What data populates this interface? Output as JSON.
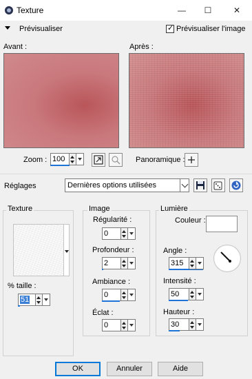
{
  "window": {
    "title": "Texture",
    "minimize": "—",
    "maximize": "☐",
    "close": "✕"
  },
  "preview_toggle": {
    "label": "Prévisualiser",
    "checkbox_label": "Prévisualiser l'image",
    "checked": true
  },
  "panes": {
    "before_label": "Avant :",
    "after_label": "Après :"
  },
  "zoom": {
    "label": "Zoom :",
    "value": "100",
    "pan_label": "Panoramique :"
  },
  "presets": {
    "label": "Réglages",
    "selected": "Dernières options utilisées"
  },
  "texture_group": {
    "title": "Texture",
    "size_label": "% taille :",
    "size_value": "51"
  },
  "image_group": {
    "title": "Image",
    "regularite_label": "Régularité :",
    "regularite_value": "0",
    "profondeur_label": "Profondeur :",
    "profondeur_value": "2",
    "ambiance_label": "Ambiance :",
    "ambiance_value": "0",
    "eclat_label": "Éclat :",
    "eclat_value": "0"
  },
  "light_group": {
    "title": "Lumière",
    "couleur_label": "Couleur :",
    "angle_label": "Angle :",
    "angle_value": "315",
    "intensite_label": "Intensité :",
    "intensite_value": "50",
    "hauteur_label": "Hauteur :",
    "hauteur_value": "30"
  },
  "buttons": {
    "ok": "OK",
    "cancel": "Annuler",
    "help": "Aide"
  },
  "colors": {
    "accent": "#1e73d8",
    "preview_red": "#c47073"
  }
}
